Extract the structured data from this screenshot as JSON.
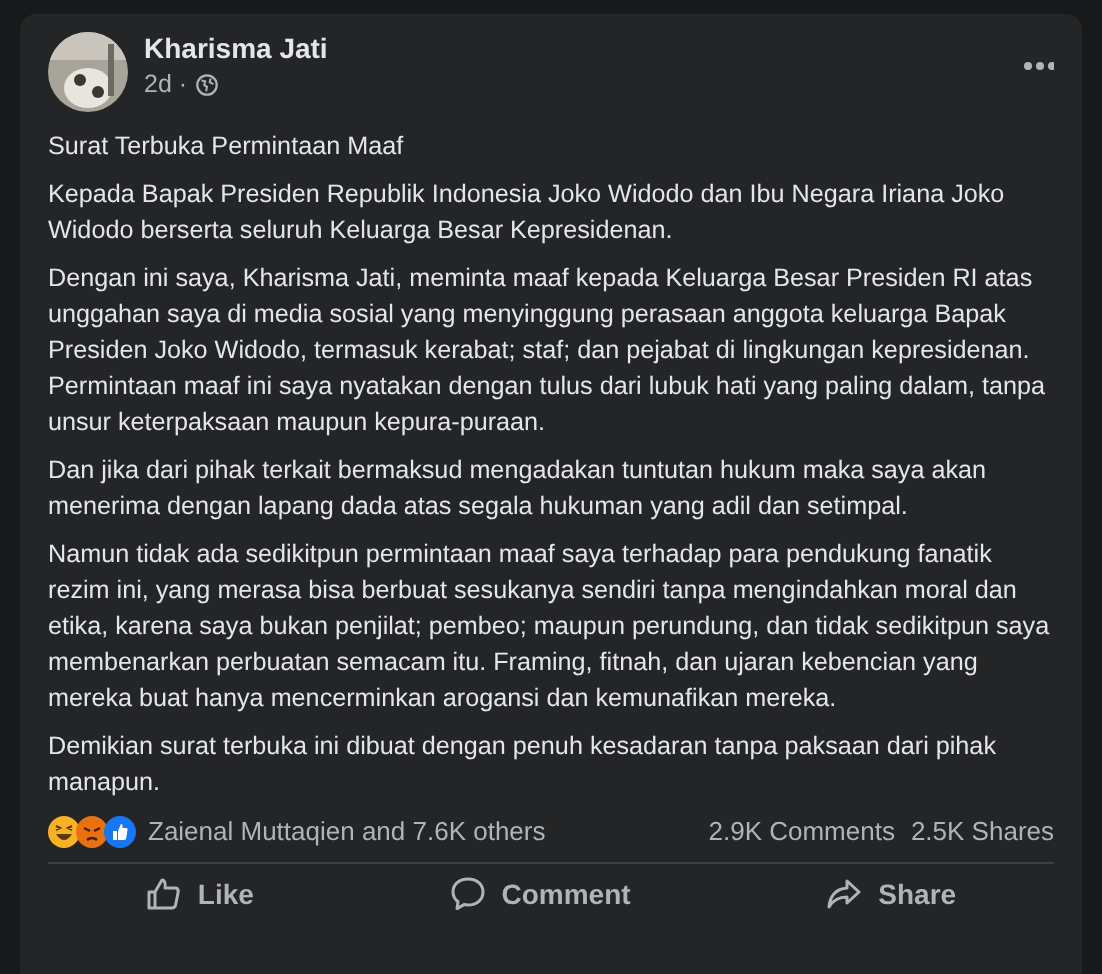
{
  "post": {
    "author": "Kharisma Jati",
    "time": "2d ·",
    "paragraphs": [
      "Surat Terbuka Permintaan Maaf",
      "Kepada Bapak Presiden Republik Indonesia Joko Widodo dan Ibu Negara Iriana Joko Widodo berserta seluruh Keluarga Besar Kepresidenan.",
      "Dengan ini saya, Kharisma Jati, meminta maaf kepada Keluarga Besar Presiden RI atas unggahan saya di media sosial yang menyinggung perasaan anggota keluarga Bapak Presiden Joko Widodo, termasuk kerabat; staf; dan pejabat di lingkungan kepresidenan. Permintaan maaf ini saya nyatakan dengan tulus dari lubuk hati yang paling dalam, tanpa unsur keterpaksaan maupun kepura-puraan.",
      "Dan jika dari pihak terkait bermaksud mengadakan tuntutan hukum maka saya akan menerima dengan lapang dada atas segala hukuman yang adil dan setimpal.",
      "Namun tidak ada sedikitpun permintaan maaf saya terhadap para pendukung fanatik rezim ini, yang merasa bisa berbuat sesukanya sendiri tanpa mengindahkan moral dan etika, karena saya bukan penjilat; pembeo; maupun perundung, dan tidak sedikitpun saya membenarkan perbuatan semacam itu. Framing, fitnah, dan ujaran kebencian yang mereka buat hanya mencerminkan arogansi dan kemunafikan mereka.",
      "Demikian surat terbuka ini dibuat dengan penuh kesadaran tanpa paksaan dari pihak manapun."
    ],
    "reactions": [
      {
        "kind": "haha"
      },
      {
        "kind": "angry"
      },
      {
        "kind": "like"
      }
    ],
    "reaction_summary": "Zaienal Muttaqien and 7.6K others",
    "comments": "2.9K Comments",
    "shares": "2.5K Shares",
    "actions": [
      {
        "kind": "like",
        "label": "Like"
      },
      {
        "kind": "comment",
        "label": "Comment"
      },
      {
        "kind": "share",
        "label": "Share"
      }
    ]
  }
}
